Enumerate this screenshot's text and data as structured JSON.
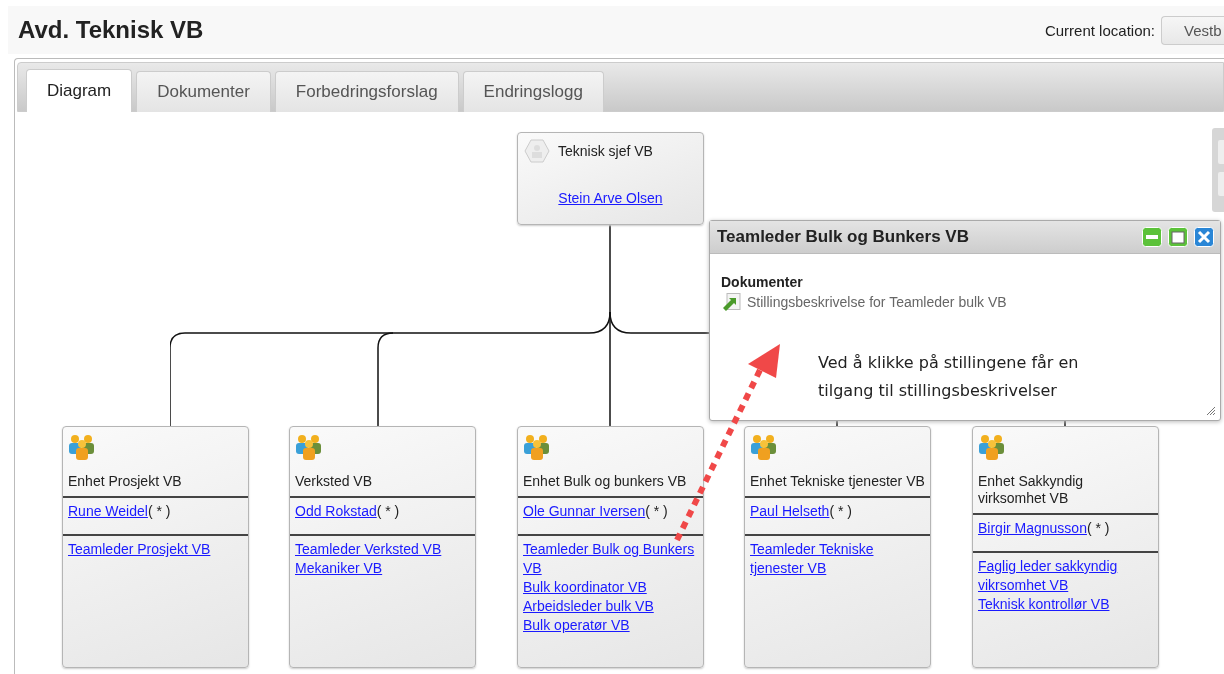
{
  "header": {
    "title": "Avd. Teknisk VB",
    "location_label": "Current location:",
    "location_value": "Vestb"
  },
  "tabs": [
    {
      "label": "Diagram",
      "selected": true
    },
    {
      "label": "Dokumenter",
      "selected": false
    },
    {
      "label": "Forbedringsforslag",
      "selected": false
    },
    {
      "label": "Endringslogg",
      "selected": false
    }
  ],
  "diagram": {
    "root": {
      "title": "Teknisk sjef VB",
      "person": "Stein Arve Olsen"
    },
    "units": [
      {
        "title": "Enhet Prosjekt VB",
        "person": "Rune Weidel",
        "marker": "( * )",
        "roles": [
          "Teamleder Prosjekt VB"
        ]
      },
      {
        "title": "Verksted VB",
        "person": "Odd Rokstad",
        "marker": "( * )",
        "roles": [
          "Teamleder Verksted VB",
          "Mekaniker VB"
        ]
      },
      {
        "title": "Enhet Bulk og bunkers VB",
        "person": "Ole Gunnar Iversen",
        "marker": "( * )",
        "roles": [
          "Teamleder Bulk og Bunkers VB",
          "Bulk koordinator VB",
          "Arbeidsleder bulk VB",
          "Bulk operatør VB"
        ]
      },
      {
        "title": "Enhet Tekniske tjenester VB",
        "person": "Paul Helseth",
        "marker": "( * )",
        "roles": [
          "Teamleder Tekniske tjenester VB"
        ]
      },
      {
        "title": "Enhet Sakkyndig virksomhet VB",
        "person": "Birgir Magnusson",
        "marker": "( * )",
        "roles": [
          "Faglig leder sakkyndig vikrsomhet VB",
          "Teknisk kontrollør VB"
        ]
      }
    ]
  },
  "popup": {
    "title": "Teamleder Bulk og Bunkers VB",
    "section": "Dokumenter",
    "documents": [
      "Stillingsbeskrivelse for Teamleder bulk VB"
    ],
    "annotation": "Ved å klikke på stillingene får en tilgang til stillingsbeskrivelser"
  }
}
